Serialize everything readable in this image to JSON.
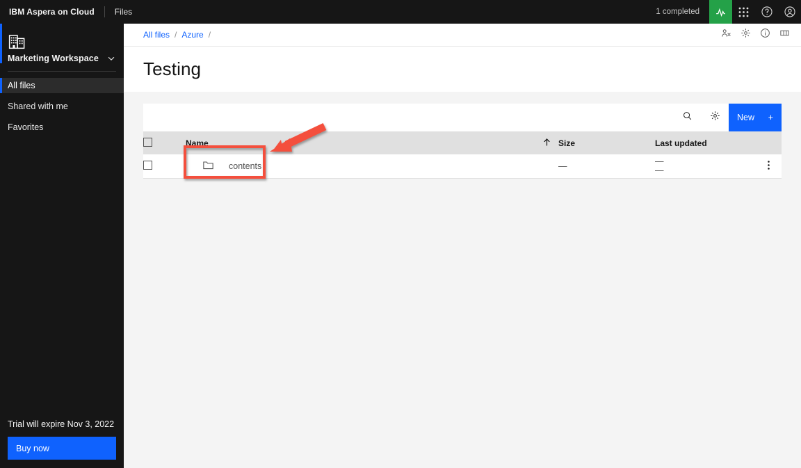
{
  "header": {
    "brand": "IBM Aspera on Cloud",
    "app": "Files",
    "status": "1 completed",
    "icons": {
      "activity": "activity-icon",
      "app_switcher": "app-switcher-icon",
      "help": "help-icon",
      "account": "user-avatar-icon"
    },
    "colors": {
      "background": "#161616",
      "activity_green": "#24a148"
    }
  },
  "sidebar": {
    "workspace": {
      "name": "Marketing Workspace",
      "icon": "enterprise-building-icon",
      "chevron": "chevron-down-icon"
    },
    "items": [
      {
        "label": "All files",
        "active": true
      },
      {
        "label": "Shared with me",
        "active": false
      },
      {
        "label": "Favorites",
        "active": false
      }
    ],
    "trial": {
      "message": "Trial will expire Nov 3, 2022",
      "cta": "Buy now"
    },
    "colors": {
      "accent": "#0f62fe",
      "active_bg": "#2c2c2c"
    }
  },
  "breadcrumb": {
    "items": [
      "All files",
      "Azure"
    ],
    "separator": "/",
    "trailing_separator": "/",
    "link_color": "#0f62fe",
    "actions": [
      {
        "name": "share-members-icon"
      },
      {
        "name": "settings-gear-icon"
      },
      {
        "name": "info-icon"
      },
      {
        "name": "panel-view-icon"
      }
    ]
  },
  "page": {
    "title": "Testing"
  },
  "toolbar": {
    "search_icon": "search-icon",
    "settings_icon": "settings-gear-icon",
    "new_label": "New",
    "new_plus": "+",
    "new_color": "#0f62fe"
  },
  "table": {
    "columns": [
      {
        "key": "check",
        "label": ""
      },
      {
        "key": "name",
        "label": "Name",
        "sorted": true,
        "sort_dir": "asc"
      },
      {
        "key": "size",
        "label": "Size"
      },
      {
        "key": "updated",
        "label": "Last updated"
      }
    ],
    "rows": [
      {
        "checked": false,
        "icon": "folder-icon",
        "name": "contents",
        "size": "—",
        "updated_line1": "—",
        "updated_line2": "—",
        "menu": "overflow-menu-icon"
      }
    ]
  },
  "annotations": {
    "highlight_box": {
      "color": "#f4503c",
      "target": "contents"
    },
    "arrow": {
      "color": "#f4503c",
      "direction": "down-left"
    }
  }
}
